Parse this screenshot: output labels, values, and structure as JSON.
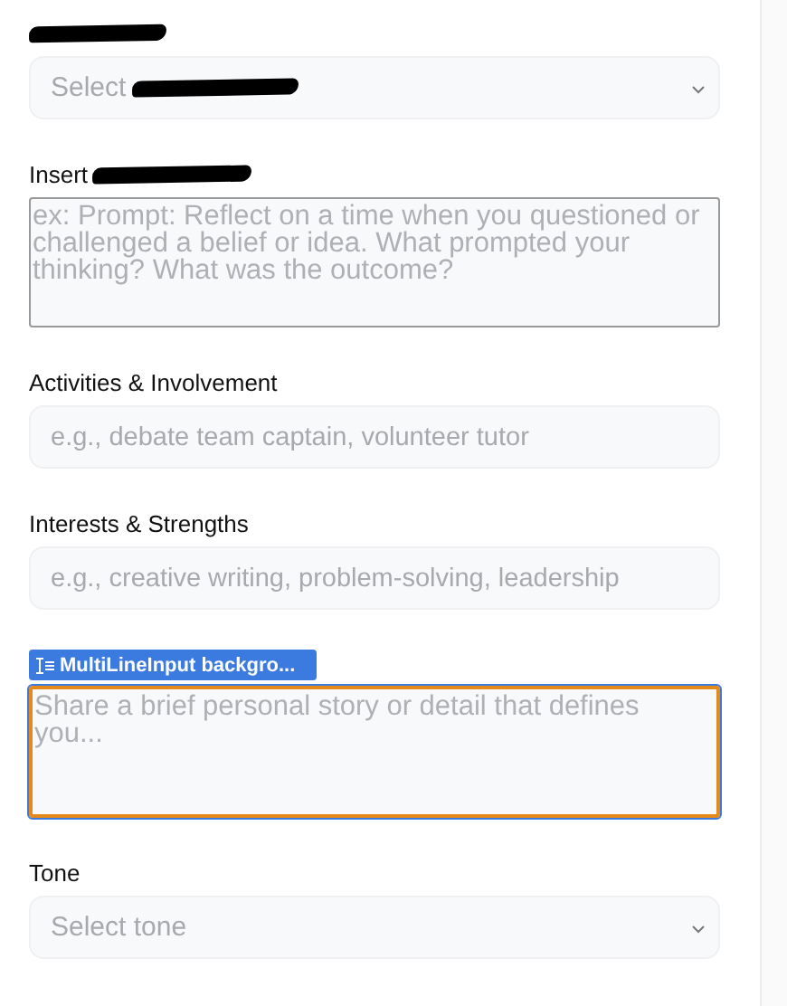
{
  "fields": [
    {
      "kind": "select",
      "label_redacted": true,
      "placeholder": "Select",
      "placeholder_redacted": true
    },
    {
      "kind": "textarea",
      "label": "Insert",
      "label_redacted": true,
      "placeholder": "ex: Prompt: Reflect on a time when you questioned or challenged a belief or idea. What prompted your thinking? What was the outcome?",
      "focused": false
    },
    {
      "kind": "input",
      "label": "Activities & Involvement",
      "placeholder": "e.g., debate team captain, volunteer tutor"
    },
    {
      "kind": "input",
      "label": "Interests & Strengths",
      "placeholder": "e.g., creative writing, problem-solving, leadership"
    },
    {
      "kind": "textarea",
      "inspector_tag": "MultiLineInput backgro...",
      "placeholder": "Share a brief personal story or detail that defines you...",
      "focused": true
    },
    {
      "kind": "select",
      "label": "Tone",
      "placeholder": "Select tone"
    }
  ]
}
